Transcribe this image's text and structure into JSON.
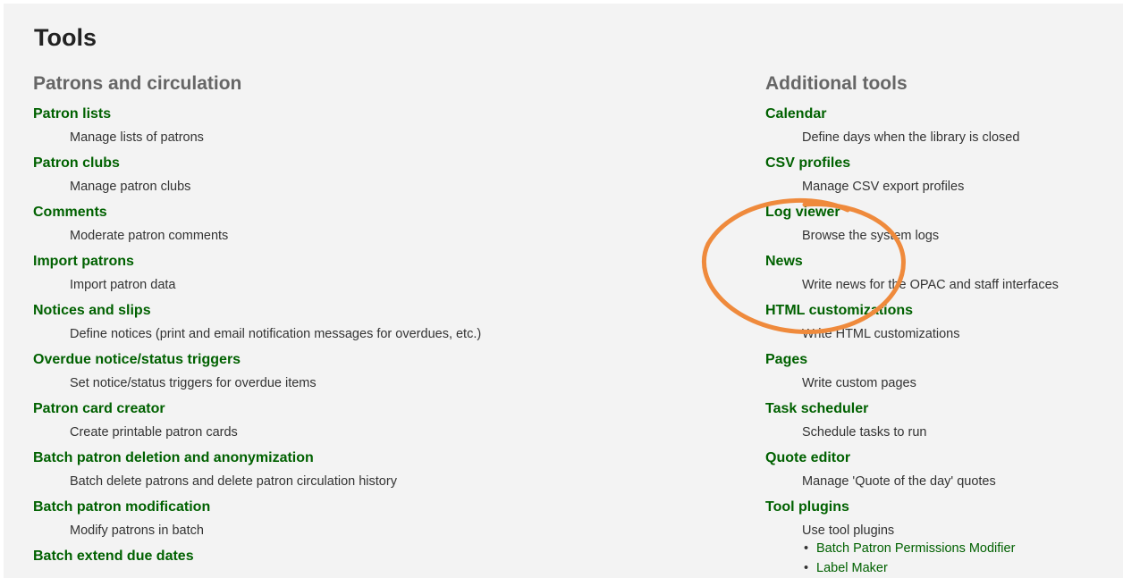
{
  "page": {
    "title": "Tools"
  },
  "patrons": {
    "heading": "Patrons and circulation",
    "items": [
      {
        "label": "Patron lists",
        "description": "Manage lists of patrons"
      },
      {
        "label": "Patron clubs",
        "description": "Manage patron clubs"
      },
      {
        "label": "Comments",
        "description": "Moderate patron comments"
      },
      {
        "label": "Import patrons",
        "description": "Import patron data"
      },
      {
        "label": "Notices and slips",
        "description": "Define notices (print and email notification messages for overdues, etc.)"
      },
      {
        "label": "Overdue notice/status triggers",
        "description": "Set notice/status triggers for overdue items"
      },
      {
        "label": "Patron card creator",
        "description": "Create printable patron cards"
      },
      {
        "label": "Batch patron deletion and anonymization",
        "description": "Batch delete patrons and delete patron circulation history"
      },
      {
        "label": "Batch patron modification",
        "description": "Modify patrons in batch"
      },
      {
        "label": "Batch extend due dates",
        "description": ""
      }
    ]
  },
  "additional": {
    "heading": "Additional tools",
    "items": [
      {
        "label": "Calendar",
        "description": "Define days when the library is closed"
      },
      {
        "label": "CSV profiles",
        "description": "Manage CSV export profiles"
      },
      {
        "label": "Log viewer",
        "description": "Browse the system logs"
      },
      {
        "label": "News",
        "description": "Write news for the OPAC and staff interfaces"
      },
      {
        "label": "HTML customizations",
        "description": "Write HTML customizations"
      },
      {
        "label": "Pages",
        "description": "Write custom pages"
      },
      {
        "label": "Task scheduler",
        "description": "Schedule tasks to run"
      },
      {
        "label": "Quote editor",
        "description": "Manage 'Quote of the day' quotes"
      },
      {
        "label": "Tool plugins",
        "description": "Use tool plugins"
      }
    ],
    "plugins": [
      {
        "label": "Batch Patron Permissions Modifier"
      },
      {
        "label": "Label Maker"
      }
    ]
  },
  "annotation": {
    "color": "#ef8a3c",
    "circles_items": [
      "Log viewer",
      "News"
    ]
  },
  "colors": {
    "link": "#006100",
    "heading": "#666666",
    "background": "#f3f3f3"
  }
}
